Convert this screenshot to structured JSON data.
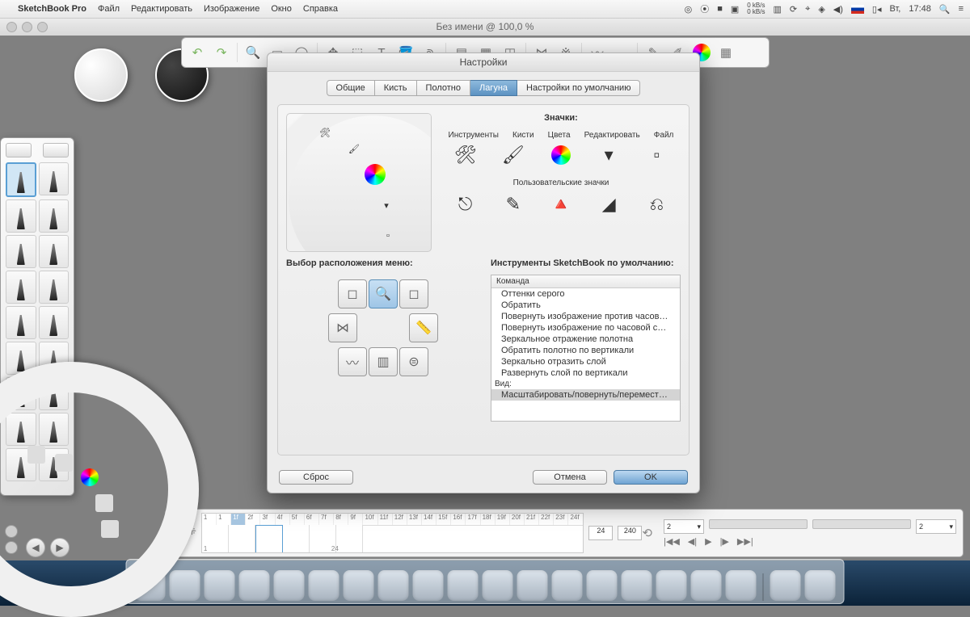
{
  "menubar": {
    "app": "SketchBook Pro",
    "items": [
      "Файл",
      "Редактировать",
      "Изображение",
      "Окно",
      "Справка"
    ],
    "day": "Вт,",
    "time": "17:48"
  },
  "window": {
    "title": "Без имени @ 100,0 %"
  },
  "toolbar": {
    "icons": [
      "undo",
      "redo",
      "|",
      "zoom",
      "marquee",
      "lasso",
      "|",
      "move",
      "transform",
      "text",
      "fill",
      "crop",
      "|",
      "layers",
      "grid",
      "ruler",
      "|",
      "symmetry",
      "symmetry-y",
      "|",
      "curve",
      "french",
      "|",
      "pencil",
      "pen",
      "color",
      "apps"
    ]
  },
  "prefs": {
    "title": "Настройки",
    "tabs": [
      "Общие",
      "Кисть",
      "Полотно",
      "Лагуна",
      "Настройки по умолчанию"
    ],
    "active_tab": 3,
    "icons_heading": "Значки:",
    "icon_labels": [
      "Инструменты",
      "Кисти",
      "Цвета",
      "Редактировать",
      "Файл"
    ],
    "user_icons_label": "Пользовательские значки",
    "menu_pos_heading": "Выбор расположения меню:",
    "default_tools_heading": "Инструменты SketchBook по умолчанию:",
    "cmd_header": "Команда",
    "commands": [
      {
        "text": "Оттенки серого",
        "indent": true
      },
      {
        "text": "Обратить",
        "indent": true
      },
      {
        "text": "Повернуть изображение против часово...",
        "indent": true
      },
      {
        "text": "Повернуть изображение по часовой стр...",
        "indent": true
      },
      {
        "text": "Зеркальное отражение полотна",
        "indent": true
      },
      {
        "text": "Обратить полотно по вертикали",
        "indent": true
      },
      {
        "text": "Зеркально отразить слой",
        "indent": true
      },
      {
        "text": "Развернуть слой по вертикали",
        "indent": true
      },
      {
        "text": "Вид:",
        "indent": false
      },
      {
        "text": "Масштабировать/повернуть/перемести...",
        "indent": true,
        "selected": true
      }
    ],
    "reset": "Сброс",
    "cancel": "Отмена",
    "ok": "OK"
  },
  "timeline": {
    "frames": [
      "1",
      "1",
      "1f",
      "2f",
      "3f",
      "4f",
      "5f",
      "6f",
      "7f",
      "8f",
      "9f",
      "10f",
      "11f",
      "12f",
      "13f",
      "14f",
      "15f",
      "16f",
      "17f",
      "18f",
      "19f",
      "20f",
      "21f",
      "22f",
      "23f",
      "24f"
    ],
    "current": 2,
    "end1": "24",
    "end2": "240",
    "spin": "2",
    "startLabel": "1",
    "endLabel": "24"
  }
}
